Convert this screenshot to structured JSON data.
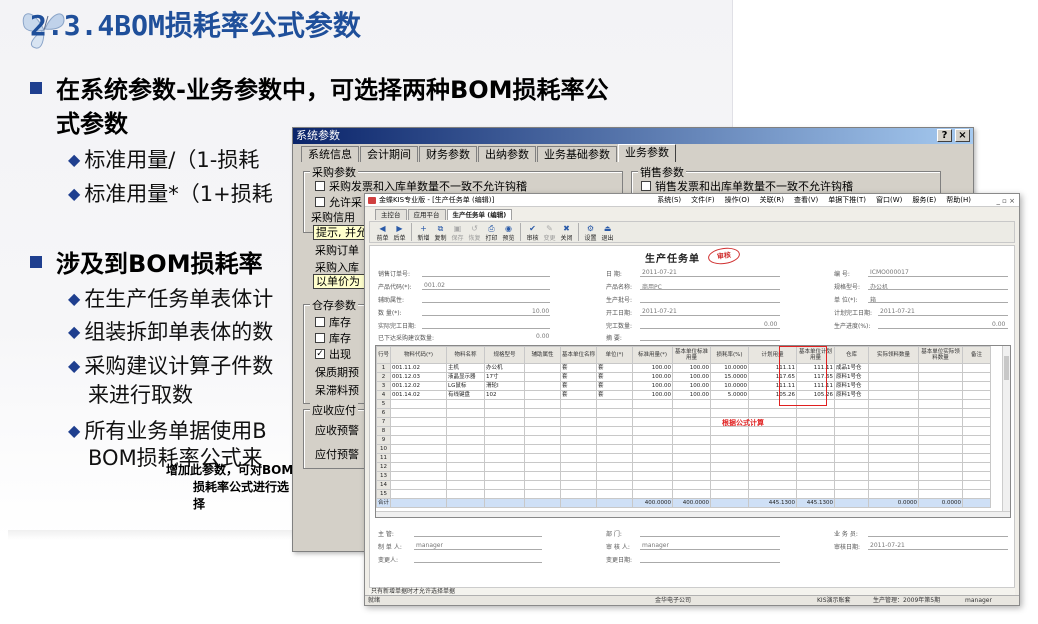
{
  "slide": {
    "title": "2.3.4BOM损耗率公式参数",
    "b1_line1": "在系统参数-业务参数中，可选择两种BOM损耗率公",
    "b1_line2": "式参数",
    "b1_sub1": "标准用量/（1-损耗",
    "b1_sub2": "标准用量*（1+损耗",
    "b2_line1": "涉及到BOM损耗率",
    "b2_sub1": "在生产任务单表体计",
    "b2_sub2": "组装拆卸单表体的数",
    "b2_sub3": "采购建议计算子件数",
    "b2_sub3b": "来进行取数",
    "b2_sub4": "所有业务单据使用B",
    "b2_sub4b": "BOM损耗率公式来",
    "note_line1": "增加此参数，可对BOM",
    "note_line2": "损耗率公式进行选",
    "note_line3": "择"
  },
  "sysparams": {
    "title": "系统参数",
    "help_btn": "?",
    "close_btn": "×",
    "tabs": [
      "系统信息",
      "会计期间",
      "财务参数",
      "出纳参数",
      "业务基础参数",
      "业务参数"
    ],
    "active_tab": "业务参数",
    "purchase_group": "采购参数",
    "purchase_chk1": "采购发票和入库单数量不一致不允许钩稽",
    "purchase_chk2": "允许采",
    "sales_group": "销售参数",
    "sales_chk1": "销售发票和出库单数量不一致不允许钩稽",
    "credit_label": "采购信用",
    "credit_value": "提示, 并允",
    "order_label": "采购订单",
    "inbound_label": "采购入库",
    "inbound_value": "以单价为",
    "stock_group": "仓存参数",
    "stock_chk1": "库存",
    "stock_chk2": "库存",
    "stock_chk3": "出现",
    "stock_chk3_checked": "✓",
    "shelf_label": "保质期预",
    "slow_label": "呆滞料预",
    "ar_group": "应收应付",
    "ar_label": "应收预警",
    "ap_label": "应付预警"
  },
  "kis": {
    "title": "金蝶KIS专业版 - [生产任务单 (编辑)]",
    "menu": [
      "系统(S)",
      "文件(F)",
      "操作(O)",
      "关联(R)",
      "查看(V)",
      "单据下推(T)",
      "窗口(W)",
      "服务(E)",
      "帮助(H)"
    ],
    "winctl": "_ ▫ ×",
    "tabs": [
      "主控台",
      "应用平台",
      "生产任务单 (编辑)"
    ],
    "active_tab": "生产任务单 (编辑)",
    "toolbar": [
      {
        "label": "前单",
        "icon": "◀",
        "enabled": true
      },
      {
        "label": "后单",
        "icon": "▶",
        "enabled": true
      },
      {
        "label": "新增",
        "icon": "+",
        "enabled": true
      },
      {
        "label": "复制",
        "icon": "⧉",
        "enabled": true
      },
      {
        "label": "保存",
        "icon": "▣",
        "enabled": false
      },
      {
        "label": "恢复",
        "icon": "↺",
        "enabled": false
      },
      {
        "label": "打印",
        "icon": "⎙",
        "enabled": true
      },
      {
        "label": "预览",
        "icon": "◉",
        "enabled": true
      },
      {
        "label": "审核",
        "icon": "✔",
        "enabled": true
      },
      {
        "label": "变更",
        "icon": "✎",
        "enabled": false
      },
      {
        "label": "关闭",
        "icon": "✖",
        "enabled": true
      },
      {
        "label": "设置",
        "icon": "⚙",
        "enabled": true
      },
      {
        "label": "退出",
        "icon": "⏏",
        "enabled": true
      }
    ],
    "form_title": "生产任务单",
    "stamp": "审核",
    "left_fields": [
      {
        "label": "销售订单号:",
        "value": ""
      },
      {
        "label": "产品代码(*):",
        "value": "001.02"
      },
      {
        "label": "辅助属性:",
        "value": ""
      },
      {
        "label": "数  量(*):",
        "value": "10.00"
      },
      {
        "label": "实际完工日期:",
        "value": ""
      },
      {
        "label": "已下达采购建议数量:",
        "value": "0.00"
      }
    ],
    "mid_fields": [
      {
        "label": "日    期:",
        "value": "2011-07-21"
      },
      {
        "label": "产品名称:",
        "value": "商用PC"
      },
      {
        "label": "生产批号:",
        "value": ""
      },
      {
        "label": "开工日期:",
        "value": "2011-07-21"
      },
      {
        "label": "完工数量:",
        "value": "0.00"
      },
      {
        "label": "摘    要:",
        "value": ""
      }
    ],
    "right_fields": [
      {
        "label": "编    号:",
        "value": "ICMO000017"
      },
      {
        "label": "规格型号:",
        "value": "办公机"
      },
      {
        "label": "单  位(*):",
        "value": "箱"
      },
      {
        "label": "计划完工日期:",
        "value": "2011-07-21"
      },
      {
        "label": "生产进度(%):",
        "value": "0.00"
      }
    ],
    "grid_headers": [
      "行号",
      "物料代码(*)",
      "物料名称",
      "规格型号",
      "辅助属性",
      "基本单位名称",
      "单位(*)",
      "标准用量(*)",
      "基本单位标准用量",
      "损耗率(%)",
      "计划用量",
      "基本单位计划用量",
      "仓库",
      "实际领料数量",
      "基本单位实际领料数量",
      "备注"
    ],
    "rows": [
      [
        "1",
        "001.11.02",
        "主机",
        "办公机",
        "",
        "套",
        "套",
        "100.00",
        "100.00",
        "10.0000",
        "111.11",
        "111.11",
        "成品1号仓",
        "",
        "",
        ""
      ],
      [
        "2",
        "001.12.03",
        "液晶显示器",
        "17寸",
        "",
        "套",
        "套",
        "100.00",
        "100.00",
        "15.0000",
        "117.65",
        "117.65",
        "原料1号仓",
        "",
        "",
        ""
      ],
      [
        "3",
        "001.12.02",
        "LG鼠标",
        "滑轮I",
        "",
        "套",
        "套",
        "100.00",
        "100.00",
        "10.0000",
        "111.11",
        "111.11",
        "原料1号仓",
        "",
        "",
        ""
      ],
      [
        "4",
        "001.14.02",
        "有线键盘",
        "102",
        "",
        "套",
        "套",
        "100.00",
        "100.00",
        "5.0000",
        "105.26",
        "105.26",
        "原料1号仓",
        "",
        "",
        ""
      ]
    ],
    "empty_rows": [
      "5",
      "6",
      "7",
      "8",
      "9",
      "10",
      "11",
      "12",
      "13",
      "14",
      "15"
    ],
    "total": {
      "label": "合计",
      "std_qty": "400.0000",
      "base_std_qty": "400.0000",
      "plan_qty": "445.1300",
      "base_plan_qty": "445.1300",
      "actual": "0.0000",
      "base_actual": "0.0000"
    },
    "formula_note": "根据公式计算",
    "footer_row1": [
      {
        "label": "主    管:",
        "value": ""
      },
      {
        "label": "部    门:",
        "value": ""
      },
      {
        "label": "业 务 员:",
        "value": ""
      }
    ],
    "footer_row2": [
      {
        "label": "制 单 人:",
        "value": "manager"
      },
      {
        "label": "审 核 人:",
        "value": "manager"
      },
      {
        "label": "审核日期:",
        "value": "2011-07-21"
      }
    ],
    "footer_row3": [
      {
        "label": "变更人:",
        "value": ""
      },
      {
        "label": "变更日期:",
        "value": ""
      }
    ],
    "status_note": "只有新增单据时才允许选择单据",
    "status_ready": "就绪",
    "status_company": "金华电子公司",
    "status_account": "KIS演示账套",
    "status_period": "生产管理：2009年第5期",
    "status_user": "manager"
  }
}
